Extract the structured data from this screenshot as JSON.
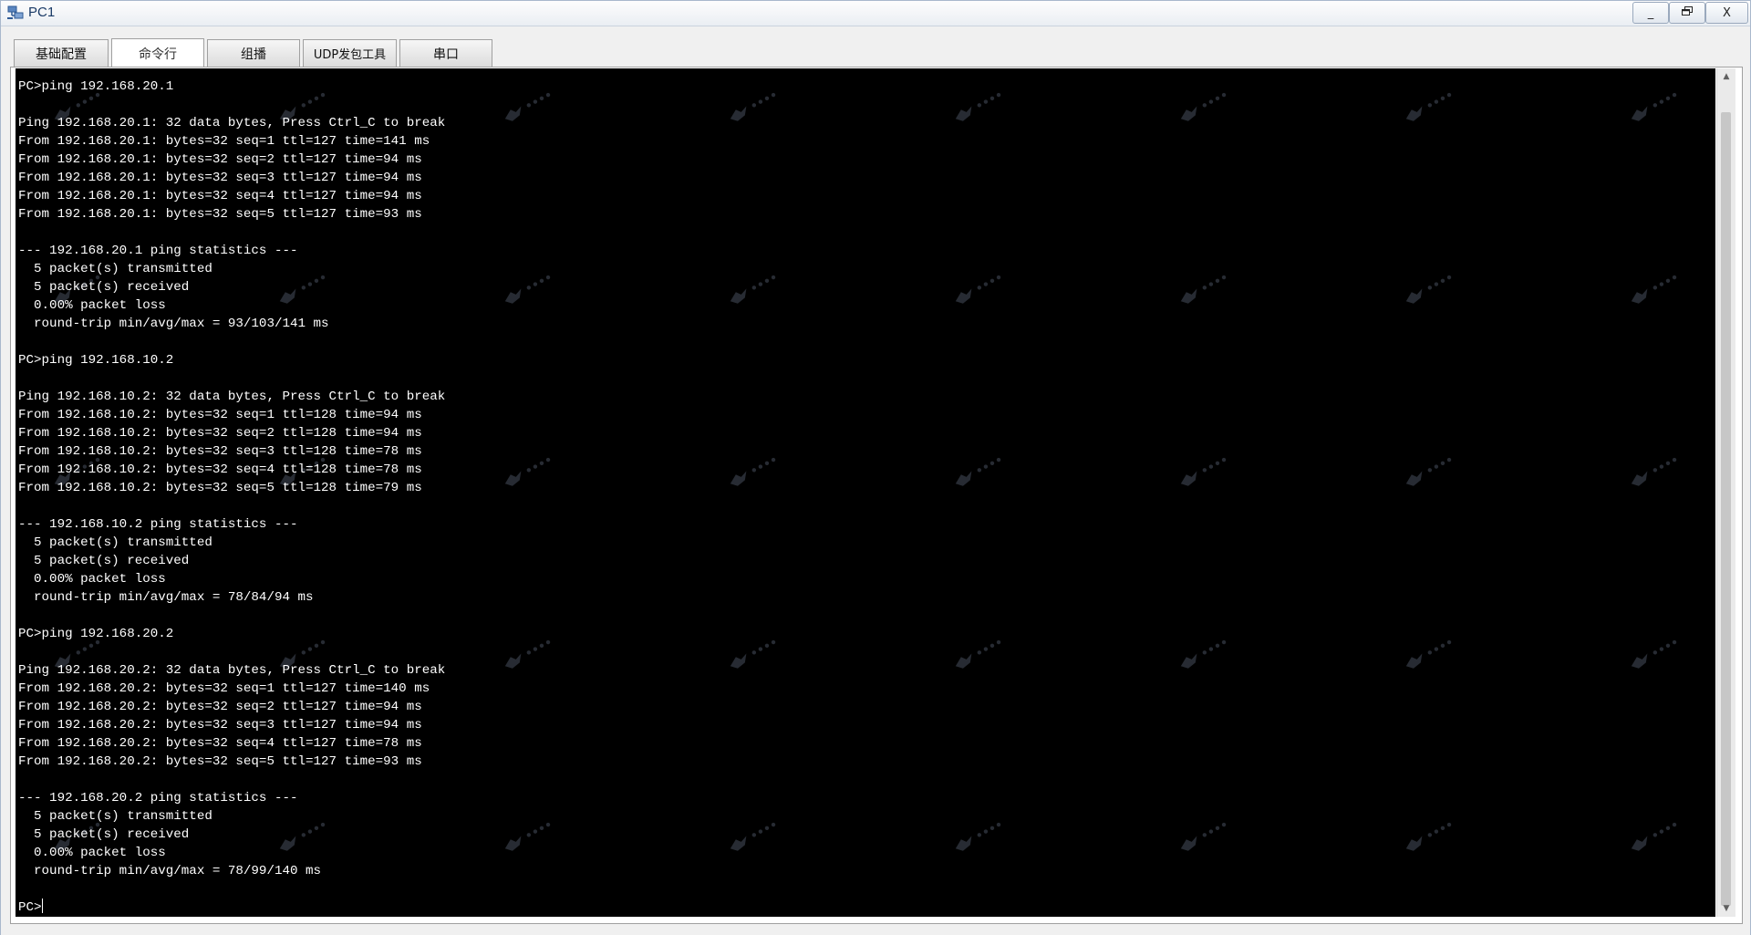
{
  "window": {
    "title": "PC1",
    "minimize_glyph": "_",
    "restore_glyph": "🗗",
    "close_glyph": "X"
  },
  "tabs": [
    {
      "label": "基础配置",
      "active": false
    },
    {
      "label": "命令行",
      "active": true
    },
    {
      "label": "组播",
      "active": false
    },
    {
      "label": "UDP发包工具",
      "active": false
    },
    {
      "label": "串口",
      "active": false
    }
  ],
  "terminal": {
    "lines": [
      "PC>ping 192.168.20.1",
      "",
      "Ping 192.168.20.1: 32 data bytes, Press Ctrl_C to break",
      "From 192.168.20.1: bytes=32 seq=1 ttl=127 time=141 ms",
      "From 192.168.20.1: bytes=32 seq=2 ttl=127 time=94 ms",
      "From 192.168.20.1: bytes=32 seq=3 ttl=127 time=94 ms",
      "From 192.168.20.1: bytes=32 seq=4 ttl=127 time=94 ms",
      "From 192.168.20.1: bytes=32 seq=5 ttl=127 time=93 ms",
      "",
      "--- 192.168.20.1 ping statistics ---",
      "  5 packet(s) transmitted",
      "  5 packet(s) received",
      "  0.00% packet loss",
      "  round-trip min/avg/max = 93/103/141 ms",
      "",
      "PC>ping 192.168.10.2",
      "",
      "Ping 192.168.10.2: 32 data bytes, Press Ctrl_C to break",
      "From 192.168.10.2: bytes=32 seq=1 ttl=128 time=94 ms",
      "From 192.168.10.2: bytes=32 seq=2 ttl=128 time=94 ms",
      "From 192.168.10.2: bytes=32 seq=3 ttl=128 time=78 ms",
      "From 192.168.10.2: bytes=32 seq=4 ttl=128 time=78 ms",
      "From 192.168.10.2: bytes=32 seq=5 ttl=128 time=79 ms",
      "",
      "--- 192.168.10.2 ping statistics ---",
      "  5 packet(s) transmitted",
      "  5 packet(s) received",
      "  0.00% packet loss",
      "  round-trip min/avg/max = 78/84/94 ms",
      "",
      "PC>ping 192.168.20.2",
      "",
      "Ping 192.168.20.2: 32 data bytes, Press Ctrl_C to break",
      "From 192.168.20.2: bytes=32 seq=1 ttl=127 time=140 ms",
      "From 192.168.20.2: bytes=32 seq=2 ttl=127 time=94 ms",
      "From 192.168.20.2: bytes=32 seq=3 ttl=127 time=94 ms",
      "From 192.168.20.2: bytes=32 seq=4 ttl=127 time=78 ms",
      "From 192.168.20.2: bytes=32 seq=5 ttl=127 time=93 ms",
      "",
      "--- 192.168.20.2 ping statistics ---",
      "  5 packet(s) transmitted",
      "  5 packet(s) received",
      "  0.00% packet loss",
      "  round-trip min/avg/max = 78/99/140 ms",
      ""
    ],
    "prompt": "PC>"
  },
  "colors": {
    "terminal_bg": "#000000",
    "terminal_fg": "#ffffff",
    "title_text": "#1a3a66"
  },
  "icons": {
    "app": "network-pc-icon",
    "scroll_up": "▲",
    "scroll_down": "▼"
  }
}
